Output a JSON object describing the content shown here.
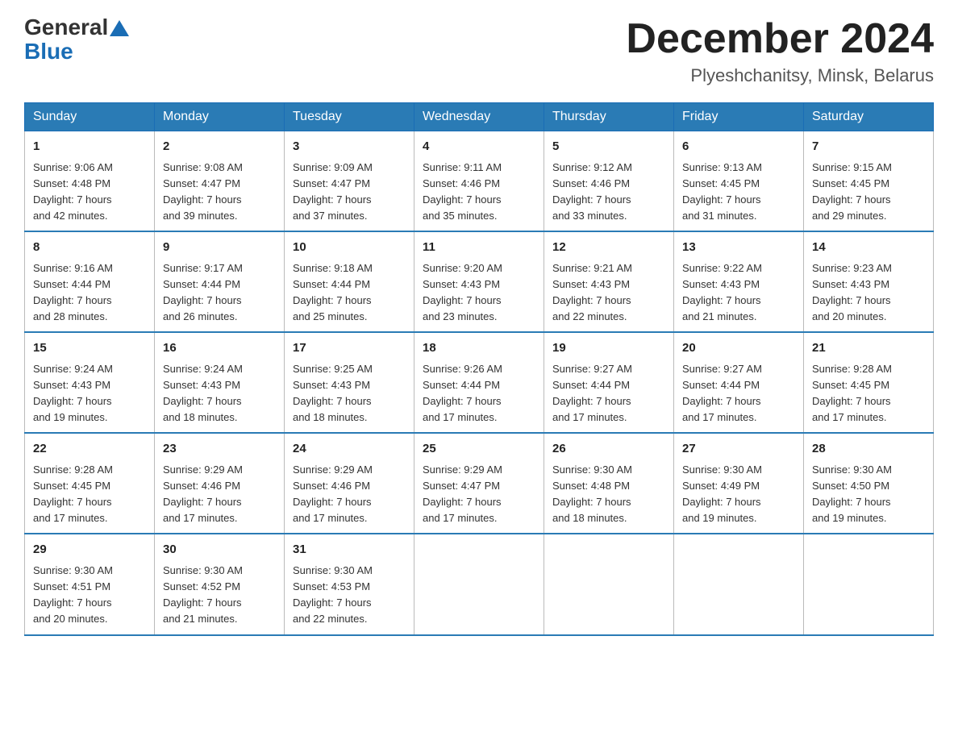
{
  "header": {
    "logo_general": "General",
    "logo_blue": "Blue",
    "month_year": "December 2024",
    "location": "Plyeshchanitsy, Minsk, Belarus"
  },
  "days_of_week": [
    "Sunday",
    "Monday",
    "Tuesday",
    "Wednesday",
    "Thursday",
    "Friday",
    "Saturday"
  ],
  "weeks": [
    [
      {
        "day": "1",
        "sunrise": "9:06 AM",
        "sunset": "4:48 PM",
        "daylight": "7 hours and 42 minutes."
      },
      {
        "day": "2",
        "sunrise": "9:08 AM",
        "sunset": "4:47 PM",
        "daylight": "7 hours and 39 minutes."
      },
      {
        "day": "3",
        "sunrise": "9:09 AM",
        "sunset": "4:47 PM",
        "daylight": "7 hours and 37 minutes."
      },
      {
        "day": "4",
        "sunrise": "9:11 AM",
        "sunset": "4:46 PM",
        "daylight": "7 hours and 35 minutes."
      },
      {
        "day": "5",
        "sunrise": "9:12 AM",
        "sunset": "4:46 PM",
        "daylight": "7 hours and 33 minutes."
      },
      {
        "day": "6",
        "sunrise": "9:13 AM",
        "sunset": "4:45 PM",
        "daylight": "7 hours and 31 minutes."
      },
      {
        "day": "7",
        "sunrise": "9:15 AM",
        "sunset": "4:45 PM",
        "daylight": "7 hours and 29 minutes."
      }
    ],
    [
      {
        "day": "8",
        "sunrise": "9:16 AM",
        "sunset": "4:44 PM",
        "daylight": "7 hours and 28 minutes."
      },
      {
        "day": "9",
        "sunrise": "9:17 AM",
        "sunset": "4:44 PM",
        "daylight": "7 hours and 26 minutes."
      },
      {
        "day": "10",
        "sunrise": "9:18 AM",
        "sunset": "4:44 PM",
        "daylight": "7 hours and 25 minutes."
      },
      {
        "day": "11",
        "sunrise": "9:20 AM",
        "sunset": "4:43 PM",
        "daylight": "7 hours and 23 minutes."
      },
      {
        "day": "12",
        "sunrise": "9:21 AM",
        "sunset": "4:43 PM",
        "daylight": "7 hours and 22 minutes."
      },
      {
        "day": "13",
        "sunrise": "9:22 AM",
        "sunset": "4:43 PM",
        "daylight": "7 hours and 21 minutes."
      },
      {
        "day": "14",
        "sunrise": "9:23 AM",
        "sunset": "4:43 PM",
        "daylight": "7 hours and 20 minutes."
      }
    ],
    [
      {
        "day": "15",
        "sunrise": "9:24 AM",
        "sunset": "4:43 PM",
        "daylight": "7 hours and 19 minutes."
      },
      {
        "day": "16",
        "sunrise": "9:24 AM",
        "sunset": "4:43 PM",
        "daylight": "7 hours and 18 minutes."
      },
      {
        "day": "17",
        "sunrise": "9:25 AM",
        "sunset": "4:43 PM",
        "daylight": "7 hours and 18 minutes."
      },
      {
        "day": "18",
        "sunrise": "9:26 AM",
        "sunset": "4:44 PM",
        "daylight": "7 hours and 17 minutes."
      },
      {
        "day": "19",
        "sunrise": "9:27 AM",
        "sunset": "4:44 PM",
        "daylight": "7 hours and 17 minutes."
      },
      {
        "day": "20",
        "sunrise": "9:27 AM",
        "sunset": "4:44 PM",
        "daylight": "7 hours and 17 minutes."
      },
      {
        "day": "21",
        "sunrise": "9:28 AM",
        "sunset": "4:45 PM",
        "daylight": "7 hours and 17 minutes."
      }
    ],
    [
      {
        "day": "22",
        "sunrise": "9:28 AM",
        "sunset": "4:45 PM",
        "daylight": "7 hours and 17 minutes."
      },
      {
        "day": "23",
        "sunrise": "9:29 AM",
        "sunset": "4:46 PM",
        "daylight": "7 hours and 17 minutes."
      },
      {
        "day": "24",
        "sunrise": "9:29 AM",
        "sunset": "4:46 PM",
        "daylight": "7 hours and 17 minutes."
      },
      {
        "day": "25",
        "sunrise": "9:29 AM",
        "sunset": "4:47 PM",
        "daylight": "7 hours and 17 minutes."
      },
      {
        "day": "26",
        "sunrise": "9:30 AM",
        "sunset": "4:48 PM",
        "daylight": "7 hours and 18 minutes."
      },
      {
        "day": "27",
        "sunrise": "9:30 AM",
        "sunset": "4:49 PM",
        "daylight": "7 hours and 19 minutes."
      },
      {
        "day": "28",
        "sunrise": "9:30 AM",
        "sunset": "4:50 PM",
        "daylight": "7 hours and 19 minutes."
      }
    ],
    [
      {
        "day": "29",
        "sunrise": "9:30 AM",
        "sunset": "4:51 PM",
        "daylight": "7 hours and 20 minutes."
      },
      {
        "day": "30",
        "sunrise": "9:30 AM",
        "sunset": "4:52 PM",
        "daylight": "7 hours and 21 minutes."
      },
      {
        "day": "31",
        "sunrise": "9:30 AM",
        "sunset": "4:53 PM",
        "daylight": "7 hours and 22 minutes."
      },
      null,
      null,
      null,
      null
    ]
  ],
  "labels": {
    "sunrise": "Sunrise:",
    "sunset": "Sunset:",
    "daylight": "Daylight:"
  }
}
